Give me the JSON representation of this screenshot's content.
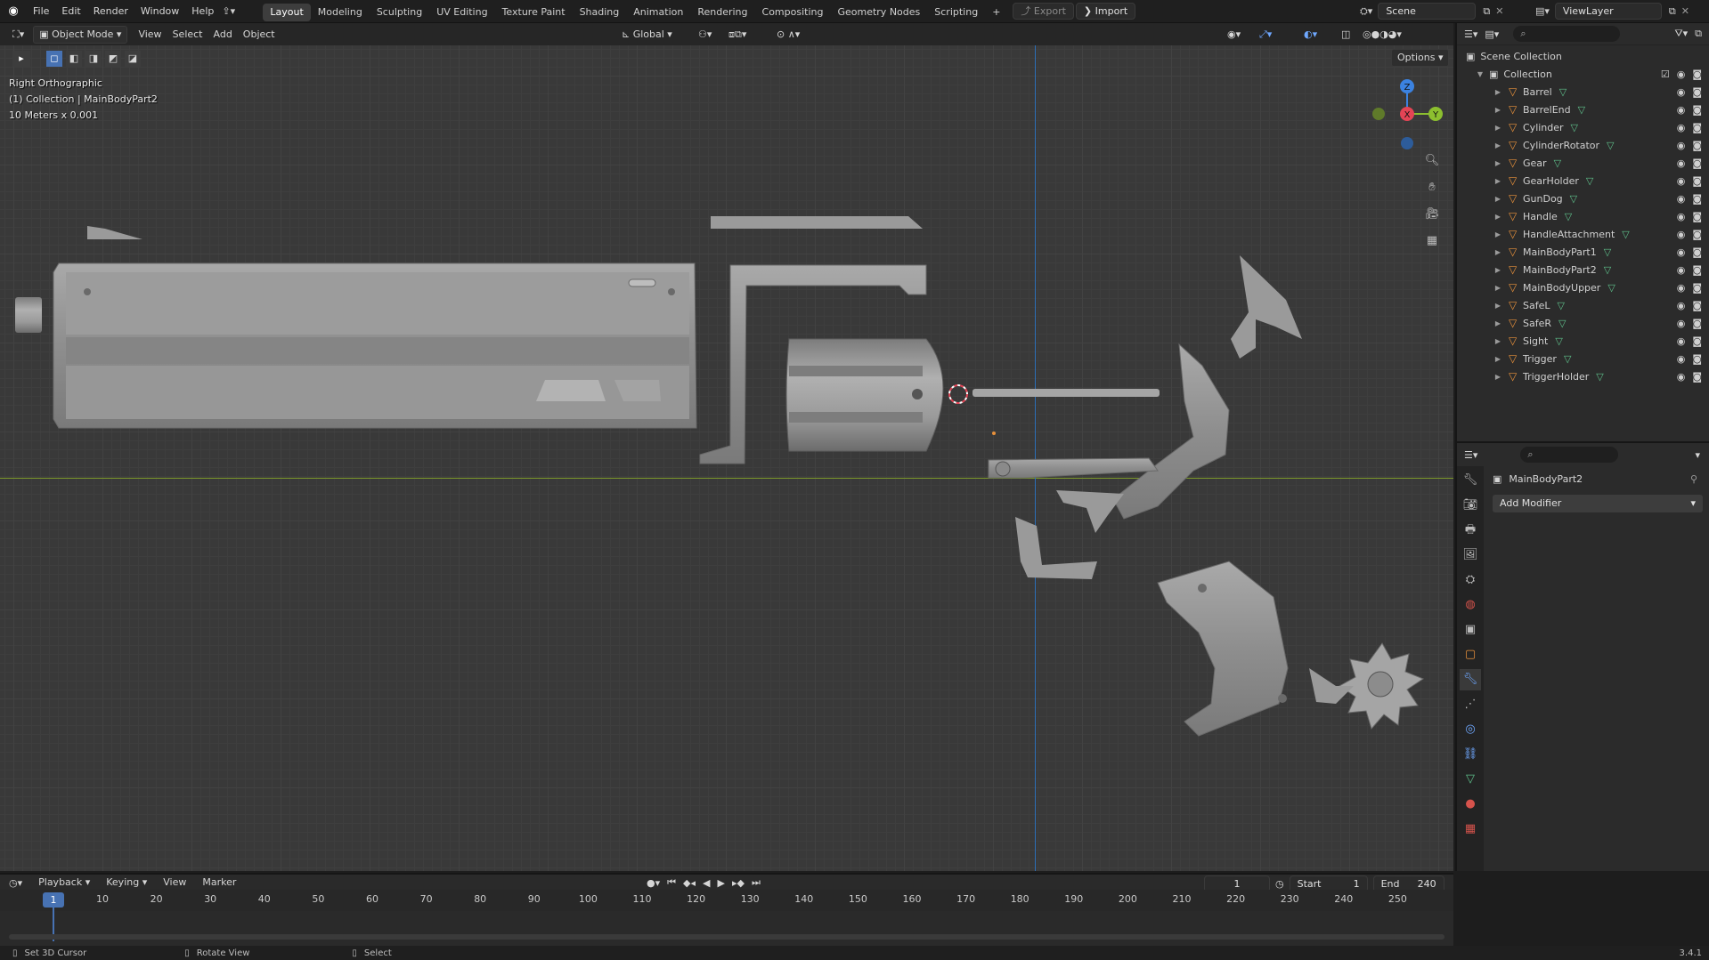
{
  "topbar": {
    "menus": [
      "File",
      "Edit",
      "Render",
      "Window",
      "Help"
    ],
    "workspaces": [
      "Layout",
      "Modeling",
      "Sculpting",
      "UV Editing",
      "Texture Paint",
      "Shading",
      "Animation",
      "Rendering",
      "Compositing",
      "Geometry Nodes",
      "Scripting"
    ],
    "active_workspace": "Layout",
    "add_tab": "+",
    "export_label": "Export",
    "import_label": "Import",
    "scene": "Scene",
    "view_layer": "ViewLayer"
  },
  "viewport_header": {
    "mode": "Object Mode",
    "menus": [
      "View",
      "Select",
      "Add",
      "Object"
    ],
    "orientation": "Global",
    "options": "Options"
  },
  "viewport": {
    "view_name": "Right Orthographic",
    "collection_info": "(1) Collection | MainBodyPart2",
    "scale_info": "10 Meters x 0.001",
    "gizmo": {
      "z": "Z",
      "x": "X",
      "y": "Y"
    }
  },
  "outliner": {
    "root": "Scene Collection",
    "collection": "Collection",
    "items": [
      "Barrel",
      "BarrelEnd",
      "Cylinder",
      "CylinderRotator",
      "Gear",
      "GearHolder",
      "GunDog",
      "Handle",
      "HandleAttachment",
      "MainBodyPart1",
      "MainBodyPart2",
      "MainBodyUpper",
      "SafeL",
      "SafeR",
      "Sight",
      "Trigger",
      "TriggerHolder"
    ],
    "active_item": "MainBodyPart2"
  },
  "properties": {
    "object_name": "MainBodyPart2",
    "add_modifier": "Add Modifier"
  },
  "timeline": {
    "menus": [
      "Playback",
      "Keying",
      "View",
      "Marker"
    ],
    "current_frame": "1",
    "start_label": "Start",
    "start_value": "1",
    "end_label": "End",
    "end_value": "240",
    "frame_marker": "1",
    "ticks": [
      "10",
      "20",
      "30",
      "40",
      "50",
      "60",
      "70",
      "80",
      "90",
      "100",
      "110",
      "120",
      "130",
      "140",
      "150",
      "160",
      "170",
      "180",
      "190",
      "200",
      "210",
      "220",
      "230",
      "240",
      "250"
    ]
  },
  "statusbar": {
    "hint1": "Set 3D Cursor",
    "hint2": "Rotate View",
    "hint3": "Select",
    "version": "3.4.1"
  },
  "colors": {
    "accent": "#4772b3",
    "mesh": "#e7903b",
    "axis_x": "#e44455",
    "axis_y": "#8cbf2f",
    "axis_z": "#3b82e0"
  }
}
